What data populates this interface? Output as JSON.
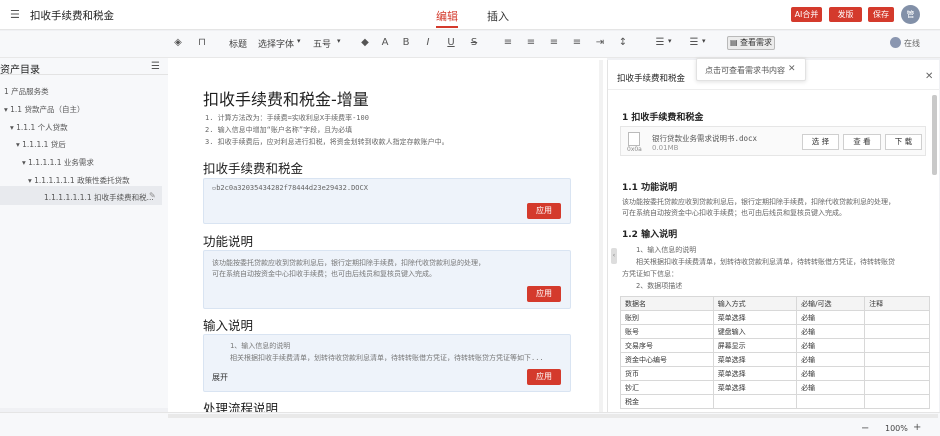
{
  "topbar": {
    "title": "扣收手续费和税金",
    "tabs": [
      "编辑",
      "插入"
    ],
    "buttons": {
      "ai": "AI合并",
      "publish": "发版",
      "save": "保存"
    },
    "avatar": "管",
    "online": "在线"
  },
  "toolbar": {
    "icons": [
      "eraser-icon",
      "lock-icon"
    ],
    "heading": "标题",
    "font": "选择字体",
    "size": "五号",
    "view_req": "查看需求"
  },
  "sidebar": {
    "title": "资产目录",
    "items": [
      "1 产品服务类",
      "1.1 贷款产品（自主）",
      "1.1.1 个人贷款",
      "1.1.1.1 贷后",
      "1.1.1.1.1 业务需求",
      "1.1.1.1.1.1 政策性委托贷款",
      "1.1.1.1.1.1.1 扣收手续费和税..."
    ]
  },
  "doc": {
    "heading": "扣收手续费和税金-增量",
    "notes": [
      "1. 计算方法改为：手续费=实收利息X手续费率-100",
      "2. 输入信息中增加“账户名称”字段，且为必填",
      "3. 扣收手续费后，应对利息进行扣税，将资金划转到收款人指定存款账户中。"
    ],
    "sections": [
      {
        "title": "扣收手续费和税金",
        "img_alt": "b2c0a32035434282f78444d23e29432.DOCX",
        "apply": "应用"
      },
      {
        "title": "功能说明",
        "text": [
          "该功能按委托贷款应收到贷款利息后，银行定期扣除手续费，扣除代收贷款利息的处理，",
          "可在系统自动按资金中心扣收手续费；也可由后线员和复核员键入完成。"
        ],
        "apply": "应用"
      },
      {
        "title": "输入说明",
        "text": [
          "1、输入信息的说明",
          "相关根据扣收手续费清单，划转待收贷款利息清单，待转转账借方凭证，待转转账贷方凭证等如下..."
        ],
        "expand": "展开",
        "apply": "应用"
      },
      {
        "title": "处理流程说明"
      }
    ]
  },
  "req": {
    "header": "扣收手续费和税金",
    "tooltip": "点击可查看需求书内容",
    "h1": "1 扣收手续费和税金",
    "file": {
      "name": "银行贷款业务需求说明书.docx",
      "size": "0.01MB",
      "thumb": "0x0a",
      "buttons": [
        "选 择",
        "查 看",
        "下 载"
      ]
    },
    "s11": "1.1 功能说明",
    "s11_text": [
      "该功能按委托贷款应收到贷款利息后，银行定期扣除手续费，扣除代收贷款利息的处理，",
      "可在系统自动按资金中心扣收手续费；也可由后线员和复核员键入完成。"
    ],
    "s12": "1.2 输入说明",
    "s12_text": [
      "1、输入信息的说明",
      "相关根据扣收手续费清单，划转待收贷款利息清单，待转转账借方凭证，待转转账贷",
      "方凭证如下信息：",
      "2、数据项描述"
    ],
    "table": {
      "headers": [
        "数据名",
        "输入方式",
        "必输/可选",
        "注释"
      ],
      "rows": [
        [
          "账别",
          "菜单选择",
          "必输",
          ""
        ],
        [
          "账号",
          "键盘输入",
          "必输",
          ""
        ],
        [
          "交易序号",
          "屏幕显示",
          "必输",
          ""
        ],
        [
          "资金中心编号",
          "菜单选择",
          "必输",
          ""
        ],
        [
          "货币",
          "菜单选择",
          "必输",
          ""
        ],
        [
          "钞汇",
          "菜单选择",
          "必输",
          ""
        ],
        [
          "税金",
          "",
          "",
          ""
        ]
      ]
    }
  },
  "status": {
    "zoom": "100%"
  },
  "colors": {
    "accent": "#d43a2c",
    "block_bg": "#eef3fa"
  }
}
